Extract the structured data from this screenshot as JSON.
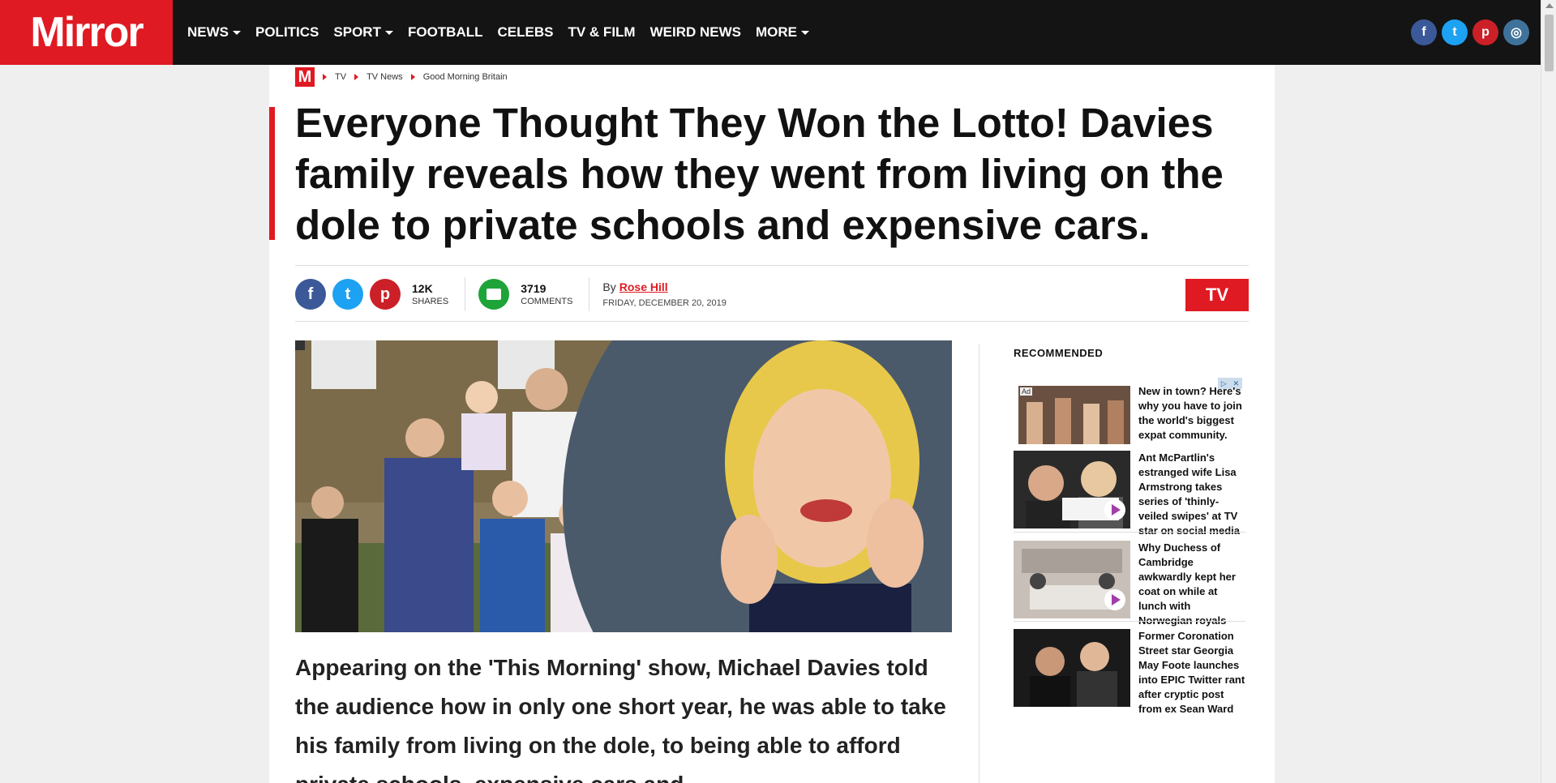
{
  "site": {
    "logo": "Mirror",
    "logo_mark": "M"
  },
  "nav": {
    "items": [
      {
        "label": "NEWS",
        "dropdown": true
      },
      {
        "label": "POLITICS",
        "dropdown": false
      },
      {
        "label": "SPORT",
        "dropdown": true
      },
      {
        "label": "FOOTBALL",
        "dropdown": false
      },
      {
        "label": "CELEBS",
        "dropdown": false
      },
      {
        "label": "TV & FILM",
        "dropdown": false
      },
      {
        "label": "WEIRD NEWS",
        "dropdown": false
      },
      {
        "label": "MORE",
        "dropdown": true
      }
    ],
    "social": [
      {
        "icon": "facebook-icon",
        "glyph": "f",
        "color": "#3b5998"
      },
      {
        "icon": "twitter-icon",
        "glyph": "t",
        "color": "#1da1f2"
      },
      {
        "icon": "pinterest-icon",
        "glyph": "p",
        "color": "#cb2027"
      },
      {
        "icon": "instagram-icon",
        "glyph": "◎",
        "color": "#3f729b"
      }
    ]
  },
  "breadcrumb": [
    "TV",
    "TV News",
    "Good Morning Britain"
  ],
  "article": {
    "headline": "Everyone Thought They Won the Lotto! Davies family reveals how they went from living on the dole to private schools and expensive cars.",
    "shares_count": "12K",
    "shares_label": "SHARES",
    "comments_count": "3719",
    "comments_label": "COMMENTS",
    "by_label": "By",
    "author": "Rose Hill",
    "date": "FRIDAY, DECEMBER 20, 2019",
    "section_tag": "TV",
    "body_text": "Appearing on the 'This Morning' show, Michael Davies told the audience how in only one short year, he was able to take his family from living on the dole, to being able to afford private schools, expensive cars and"
  },
  "sidebar": {
    "title": "RECOMMENDED",
    "ad_label": "Ad",
    "items": [
      {
        "text": "New in town? Here's why you have to join the world's biggest expat community.",
        "has_play": false,
        "is_ad": true
      },
      {
        "text": "Ant McPartlin's estranged wife Lisa Armstrong takes series of 'thinly-veiled swipes' at TV star on social media",
        "has_play": true,
        "is_ad": false
      },
      {
        "text": "Why Duchess of Cambridge awkwardly kept her coat on while at lunch with Norwegian royals",
        "has_play": true,
        "is_ad": false
      },
      {
        "text": "Former Coronation Street star Georgia May Foote launches into EPIC Twitter rant after cryptic post from ex Sean Ward",
        "has_play": false,
        "is_ad": false
      }
    ]
  },
  "colors": {
    "brand_red": "#e01a22",
    "nav_bg": "#141414",
    "comment_green": "#1ea438"
  }
}
